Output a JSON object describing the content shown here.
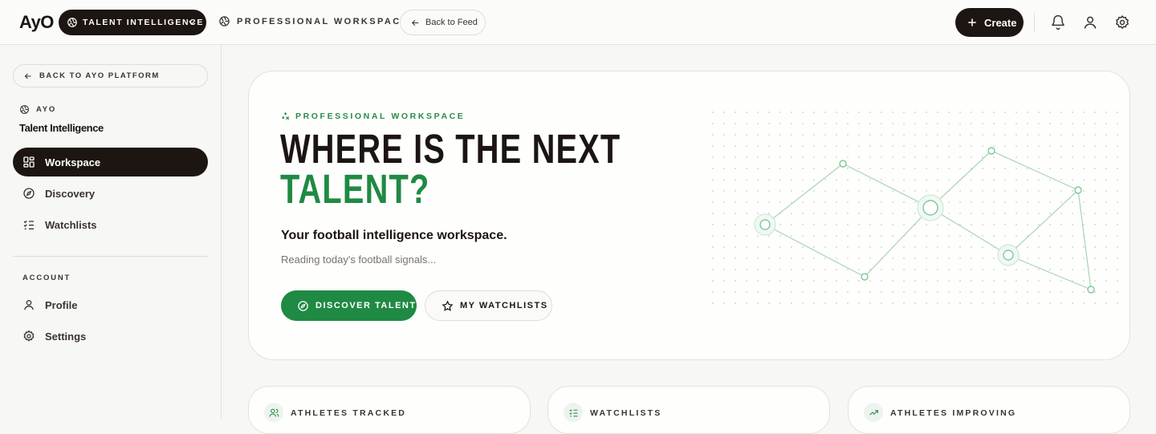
{
  "topbar": {
    "logo": "AyO",
    "context_pill": "TALENT INTELLIGENCE",
    "workspace_link": "PROFESSIONAL WORKSPACE",
    "back_to_feed": "Back to Feed",
    "create": "Create",
    "icons": [
      "bell-icon",
      "user-icon",
      "gear-icon"
    ]
  },
  "sidebar": {
    "back_to_platform": "BACK TO AYO PLATFORM",
    "brand_eyebrow": "AYO",
    "brand_title": "Talent Intelligence",
    "nav": [
      {
        "label": "Workspace",
        "icon": "grid-icon",
        "active": true
      },
      {
        "label": "Discovery",
        "icon": "compass-icon",
        "active": false
      },
      {
        "label": "Watchlists",
        "icon": "list-check-icon",
        "active": false
      }
    ],
    "account_section": "ACCOUNT",
    "account_items": [
      {
        "label": "Profile",
        "icon": "user-icon"
      },
      {
        "label": "Settings",
        "icon": "gear-icon"
      }
    ]
  },
  "hero": {
    "eyebrow": "PROFESSIONAL WORKSPACE",
    "headline_line1": "WHERE IS THE NEXT",
    "headline_line2": "TALENT?",
    "subhead": "Your football intelligence workspace.",
    "status": "Reading today's football signals...",
    "primary_button": "DISCOVER TALENT",
    "secondary_button": "MY WATCHLISTS"
  },
  "stats": [
    {
      "label": "ATHLETES TRACKED",
      "icon": "users-icon"
    },
    {
      "label": "WATCHLISTS",
      "icon": "list-check-icon"
    },
    {
      "label": "ATHLETES IMPROVING",
      "icon": "trending-up-icon"
    }
  ],
  "colors": {
    "ink": "#1c1512",
    "accent_green": "#1f8a43",
    "background": "#f7f7f5",
    "card": "#fefefd",
    "border": "#e4e2dd",
    "muted_text": "#7a726d"
  }
}
